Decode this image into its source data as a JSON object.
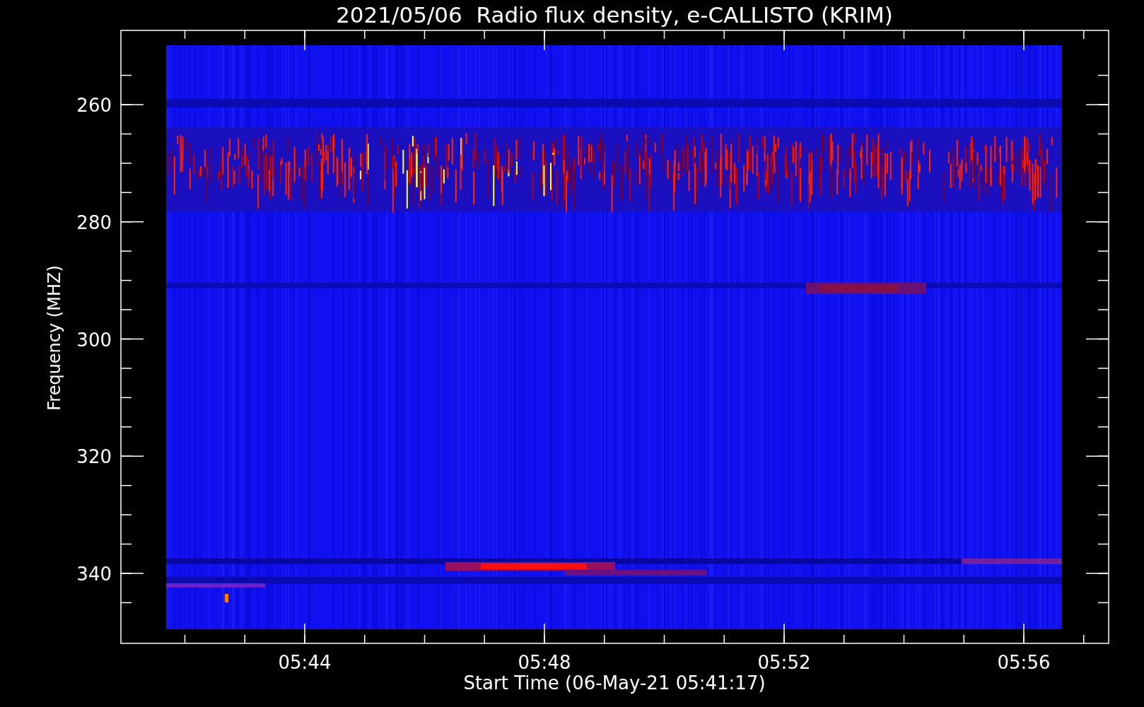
{
  "title": "2021/05/06  Radio flux density, e-CALLISTO (KRIM)",
  "y_axis": {
    "label": "Frequency (MHZ)",
    "ticks": [
      "260",
      "280",
      "300",
      "320",
      "340"
    ]
  },
  "x_axis": {
    "label": "Start Time (06-May-21 05:41:17)",
    "ticks": [
      "05:44",
      "05:48",
      "05:52",
      "05:56"
    ]
  }
}
